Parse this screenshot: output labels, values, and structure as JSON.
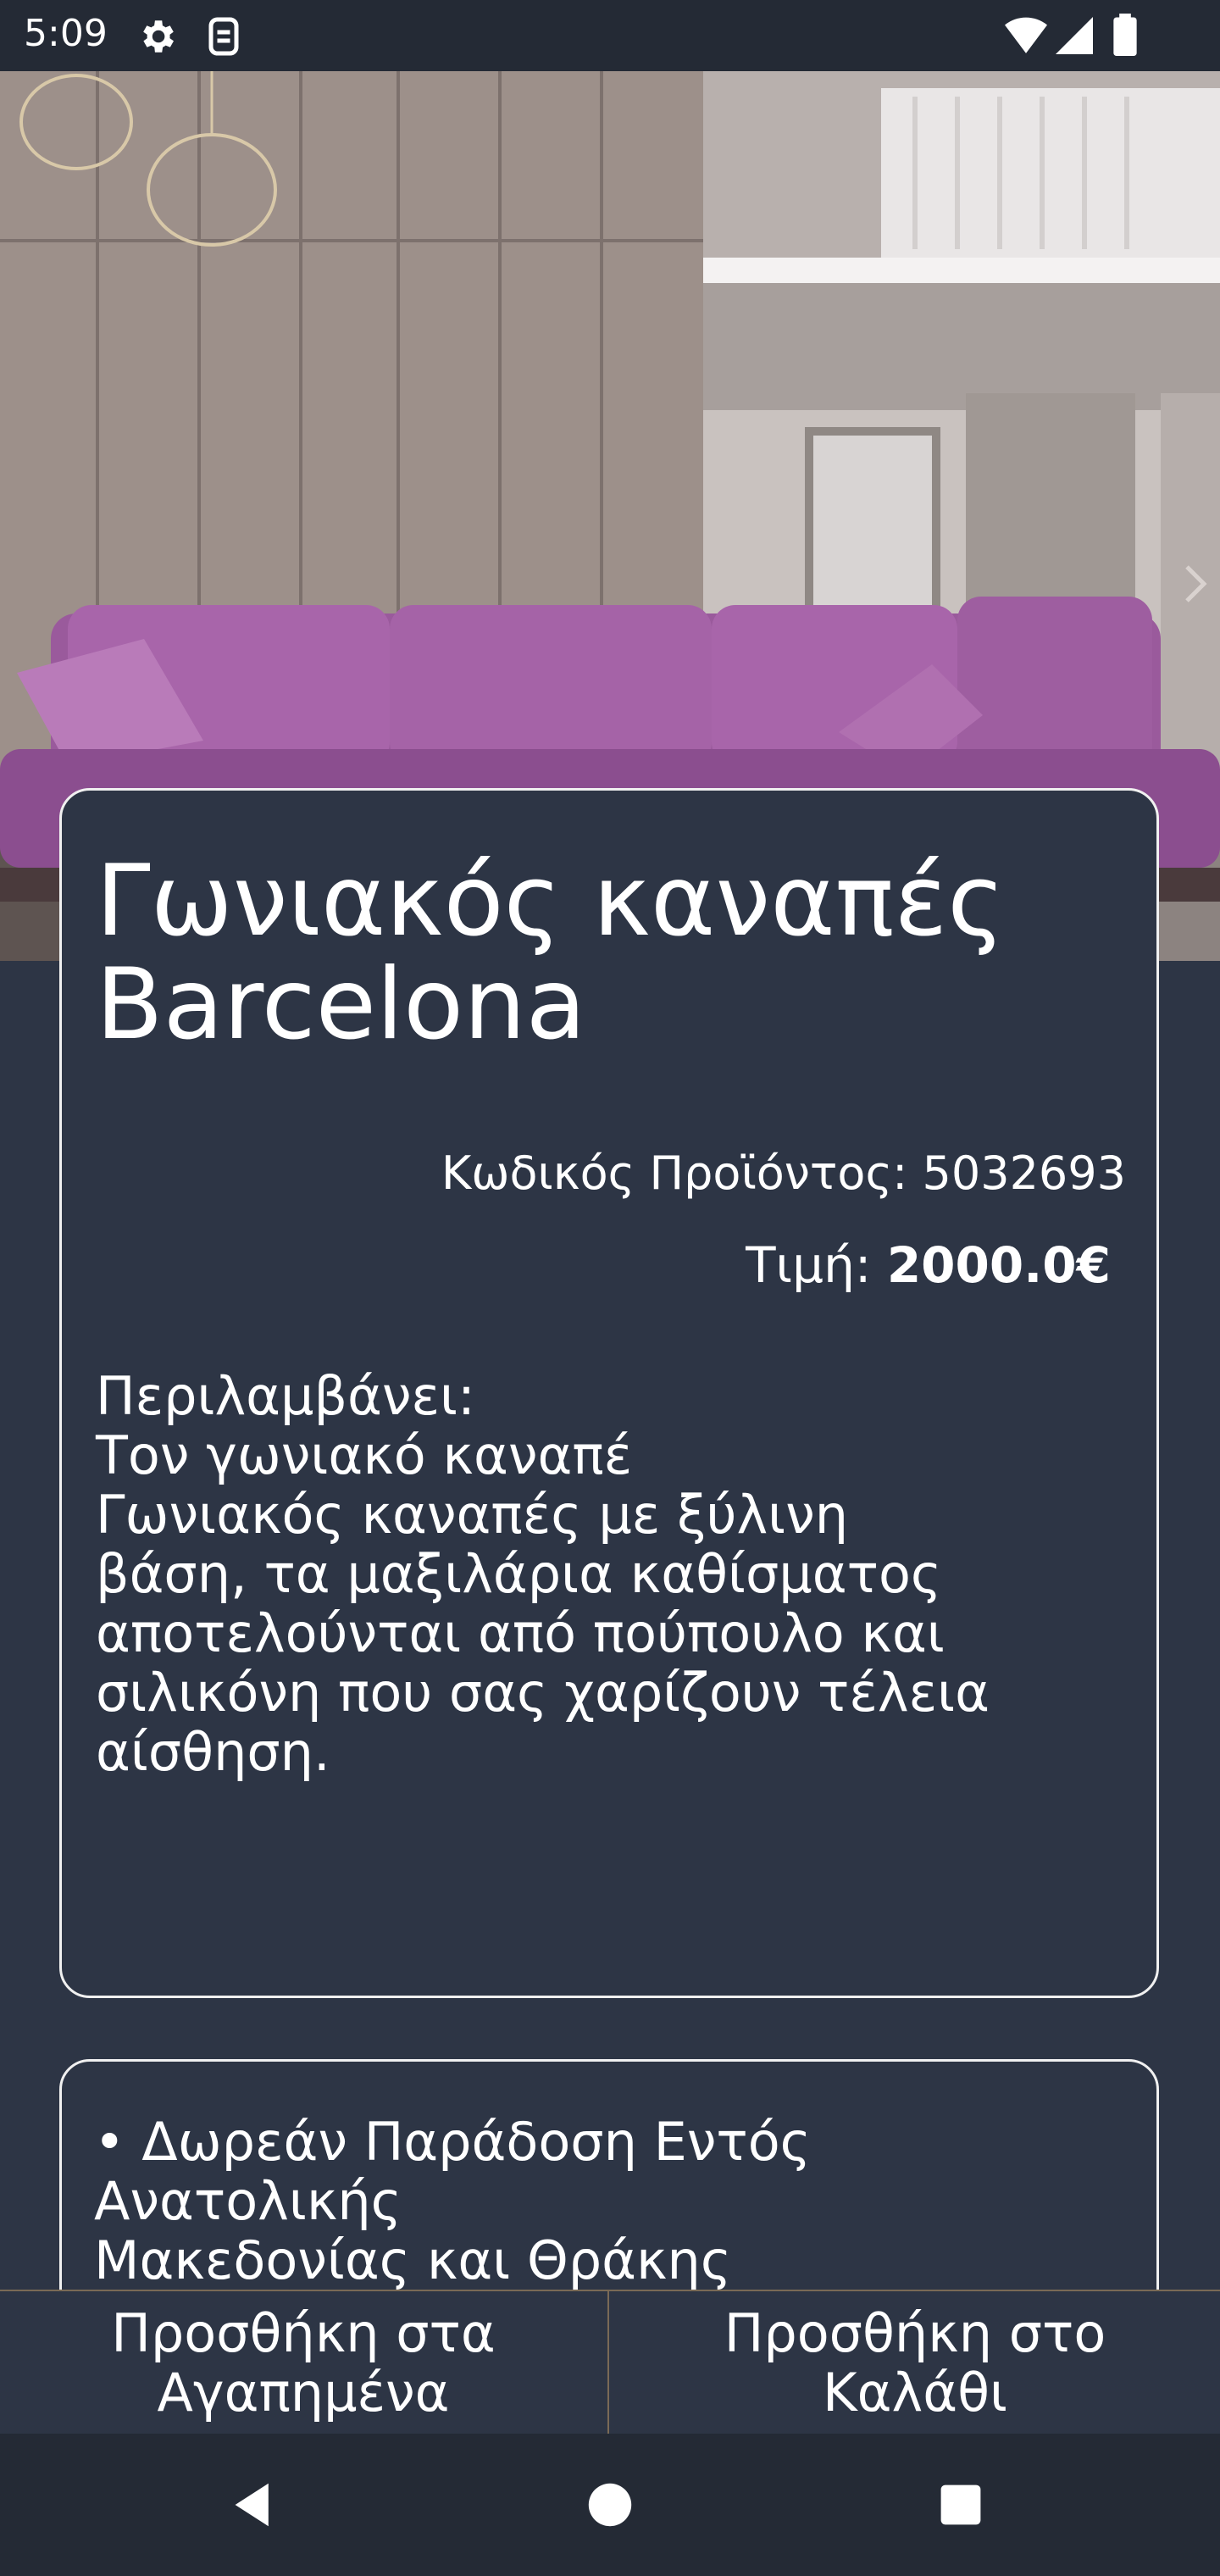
{
  "status_bar": {
    "time": "5:09",
    "icons": [
      "gear-icon",
      "sim-icon",
      "wifi-icon",
      "signal-icon",
      "battery-icon"
    ]
  },
  "hero": {
    "image": "purple-sofa-living-room-photo",
    "next_icon": "chevron-right-icon"
  },
  "product": {
    "title": "Γωνιακός καναπές Barcelona",
    "code_label": "Κωδικός Προϊόντος: 5032693",
    "price_label": "Τιμή: ",
    "price_value": "2000.0€",
    "includes": "Περιλαμβάνει:\nΤον γωνιακό καναπέ",
    "description": "Γωνιακός καναπές με ξύλινη\nβάση, τα μαξιλάρια καθίσματος\nαποτελούνται από πούπουλο και\nσιλικόνη που σας χαρίζουν τέλεια\nαίσθηση."
  },
  "delivery": {
    "text": "• Δωρεάν Παράδοση Εντός\nΑνατολικής\nΜακεδονίας και Θράκης"
  },
  "actions": {
    "favorites": "Προσθήκη στα\nΑγαπημένα",
    "cart": "Προσθήκη στο\nΚαλάθι"
  },
  "colors": {
    "background": "#2d3545",
    "bars": "#242a35",
    "card_border": "#f0f0f0",
    "divider": "#7a6a56",
    "text": "#ffffff"
  }
}
